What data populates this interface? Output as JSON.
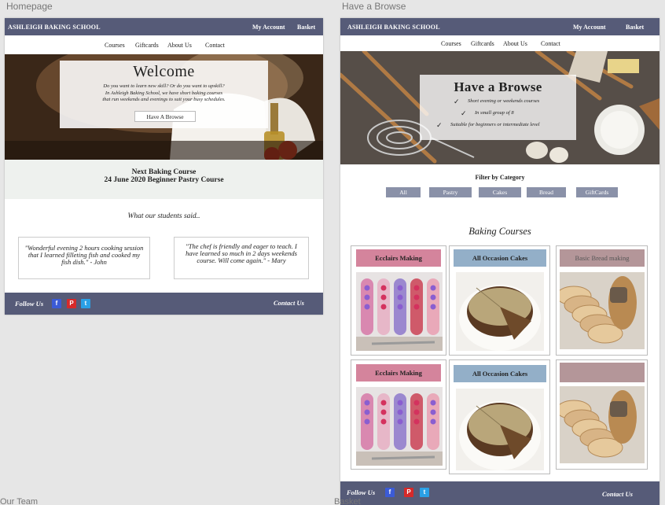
{
  "homepage": {
    "artboard_label": "Homepage",
    "brand": "ASHLEIGH BAKING SCHOOL",
    "my_account": "My Account",
    "basket": "Basket",
    "nav": [
      "Courses",
      "Giftcards",
      "About Us",
      "Contact"
    ],
    "hero_title": "Welcome",
    "hero_text": [
      "Do you want to learn new skill? Or do you want to upskill?",
      "In Ashleigh Baking School, we have short baking courses",
      "that run weekends and evenings to suit your busy schedules."
    ],
    "hero_button": "Have A Browse",
    "next_course_heading": "Next Baking Course",
    "next_course_detail": "24 June 2020 Beginner Pastry Course",
    "testimonials_heading": "What our students said..",
    "testimonials": [
      "\"Wonderful evening 2 hours cooking session that I learned filleting fish and cooked my fish dish.\" - John",
      "\"The chef is friendly and eager to teach. I have learned so much in 2 days weekends course. Will come again.\" - Mary"
    ],
    "follow_us": "Follow Us",
    "contact_us": "Contact Us"
  },
  "browse": {
    "artboard_label": "Have a Browse",
    "brand": "ASHLEIGH BAKING SCHOOL",
    "my_account": "My Account",
    "basket": "Basket",
    "nav": [
      "Courses",
      "Giftcards",
      "About Us",
      "Contact"
    ],
    "hero_title": "Have a Browse",
    "hero_points": [
      "Short evening or weekends courses",
      "In small group of 8",
      "Suitable for beginners or intermediate level"
    ],
    "filter_heading": "Filter by Category",
    "filters": [
      "All",
      "Pastry",
      "Cakes",
      "Bread",
      "GiftCards"
    ],
    "courses_heading": "Baking Courses",
    "cards": [
      {
        "title": "Ecclairs Making",
        "color": "#d4849c",
        "image": "eclairs"
      },
      {
        "title": "All Occasion Cakes",
        "color": "#93afc8",
        "image": "cake"
      },
      {
        "title": "Basic Bread making",
        "color": "#b49699",
        "image": "bread"
      },
      {
        "title": "Ecclairs Making",
        "color": "#d4849c",
        "image": "eclairs"
      },
      {
        "title": "All Occasion Cakes",
        "color": "#93afc8",
        "image": "cake"
      },
      {
        "title": "",
        "color": "#b49699",
        "image": "bread"
      }
    ],
    "follow_us": "Follow Us",
    "contact_us": "Contact Us"
  },
  "bottom_labels": [
    "Our Team",
    "Basket"
  ],
  "colors": {
    "nav_bar": "#565b78",
    "filter_button": "#8a91a8",
    "facebook": "#3b5bd6",
    "pinterest": "#d62a2a",
    "twitter": "#2aa0e6"
  }
}
